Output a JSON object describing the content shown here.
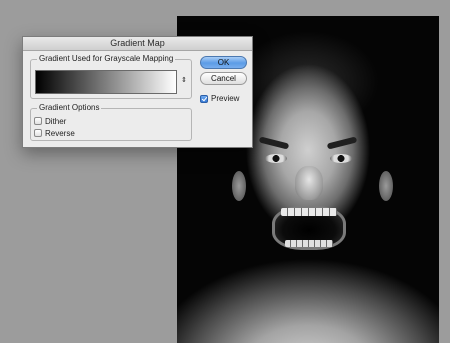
{
  "dialog": {
    "title": "Gradient Map",
    "gradient_group": {
      "label": "Gradient Used for Grayscale Mapping",
      "dropdown_glyph": "⇕",
      "gradient_colors": [
        "#000000",
        "#ffffff"
      ]
    },
    "options_group": {
      "label": "Gradient Options",
      "dither": {
        "label": "Dither",
        "checked": false
      },
      "reverse": {
        "label": "Reverse",
        "checked": false
      }
    },
    "buttons": {
      "ok_label": "OK",
      "cancel_label": "Cancel"
    },
    "preview": {
      "label": "Preview",
      "checked": true
    }
  },
  "colors": {
    "workspace_bg": "#9c9c9c",
    "dialog_bg": "#ececec",
    "ok_button_accent": "#5c9ce6"
  }
}
